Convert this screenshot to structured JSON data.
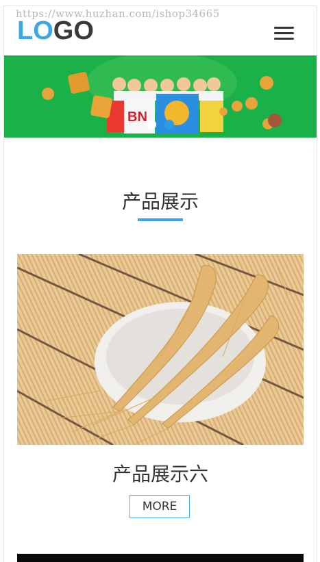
{
  "watermark": "https://www.huzhan.com/ishop34665",
  "header": {
    "logo_part1": "LO",
    "logo_part2": "GO",
    "menu_icon": "hamburger-menu-icon"
  },
  "banner": {
    "background": "#1ab248",
    "slide_count": 2,
    "active_slide": 2
  },
  "section": {
    "title": "产品展示",
    "accent_color": "#38a3ea"
  },
  "product": {
    "name": "产品展示六",
    "more_label": "MORE"
  }
}
